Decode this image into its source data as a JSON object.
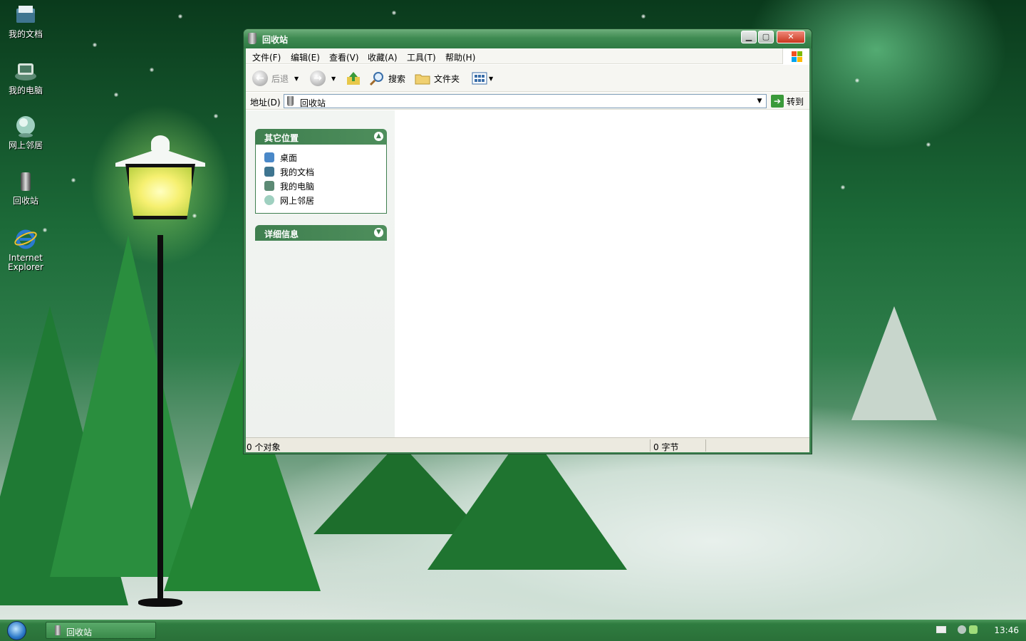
{
  "desktop": {
    "icons": [
      {
        "label": "我的文档",
        "icon": "my-documents-icon"
      },
      {
        "label": "我的电脑",
        "icon": "my-computer-icon"
      },
      {
        "label": "网上邻居",
        "icon": "network-places-icon"
      },
      {
        "label": "回收站",
        "icon": "recycle-bin-icon"
      },
      {
        "label": "Internet Explorer",
        "icon": "internet-explorer-icon"
      }
    ]
  },
  "window": {
    "title": "回收站",
    "menu": [
      "文件(F)",
      "编辑(E)",
      "查看(V)",
      "收藏(A)",
      "工具(T)",
      "帮助(H)"
    ],
    "toolbar": {
      "back": "后退",
      "search": "搜索",
      "folders": "文件夹"
    },
    "address": {
      "label": "地址(D)",
      "value": "回收站",
      "go": "转到"
    },
    "other_places": {
      "title": "其它位置",
      "items": [
        "桌面",
        "我的文档",
        "我的电脑",
        "网上邻居"
      ]
    },
    "details": {
      "title": "详细信息"
    },
    "status": {
      "objects": "0 个对象",
      "size": "0 字节"
    }
  },
  "taskbar": {
    "task_label": "回收站",
    "clock": "13:46"
  },
  "colors": {
    "titlebar": "#3f8b52",
    "taskbar": "#2f7c40",
    "panel_header": "#3f7f4f"
  }
}
